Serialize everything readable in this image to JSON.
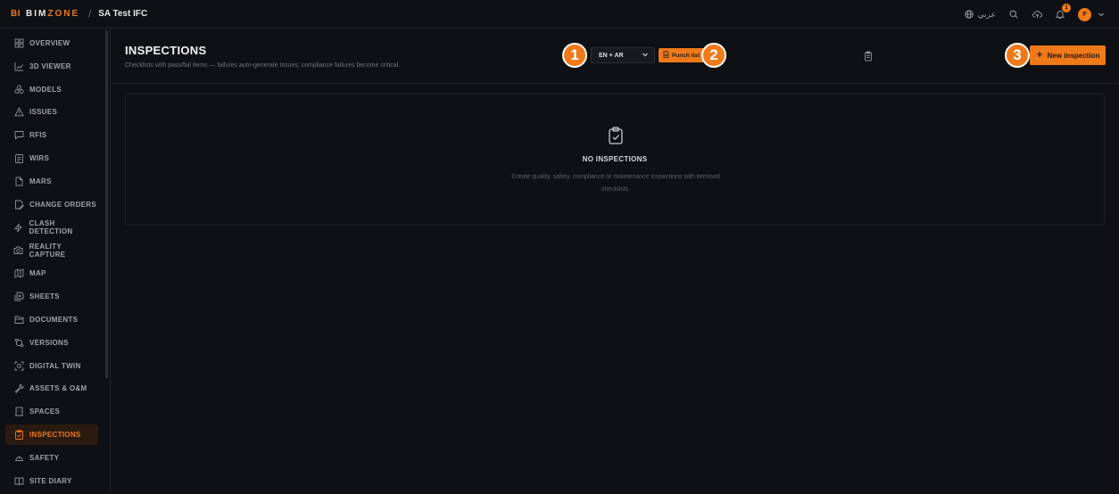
{
  "topbar": {
    "logo_badge": "BI",
    "logo_text_a": "BIM",
    "logo_text_b": "ZONE",
    "separator": "/",
    "project_name": "SA Test IFC",
    "language_label": "عربي",
    "notification_count": "1",
    "avatar_initial": "F",
    "icons": [
      "globe-icon",
      "search-icon",
      "cloud-upload-icon",
      "bell-icon",
      "chevron-down-icon"
    ]
  },
  "sidebar": {
    "items": [
      {
        "label": "OVERVIEW",
        "icon": "grid-icon",
        "active": false
      },
      {
        "label": "3D VIEWER",
        "icon": "chart-icon",
        "active": false
      },
      {
        "label": "MODELS",
        "icon": "boxes-icon",
        "active": false
      },
      {
        "label": "ISSUES",
        "icon": "warning-icon",
        "active": false
      },
      {
        "label": "RFIS",
        "icon": "message-icon",
        "active": false
      },
      {
        "label": "WIRS",
        "icon": "clipboard-list-icon",
        "active": false
      },
      {
        "label": "MARS",
        "icon": "file-icon",
        "active": false
      },
      {
        "label": "CHANGE ORDERS",
        "icon": "edit-file-icon",
        "active": false
      },
      {
        "label": "CLASH DETECTION",
        "icon": "lightning-icon",
        "active": false
      },
      {
        "label": "REALITY CAPTURE",
        "icon": "camera-icon",
        "active": false
      },
      {
        "label": "MAP",
        "icon": "map-icon",
        "active": false
      },
      {
        "label": "SHEETS",
        "icon": "sheets-icon",
        "active": false
      },
      {
        "label": "DOCUMENTS",
        "icon": "folder-icon",
        "active": false
      },
      {
        "label": "VERSIONS",
        "icon": "git-compare-icon",
        "active": false
      },
      {
        "label": "DIGITAL TWIN",
        "icon": "scan-icon",
        "active": false
      },
      {
        "label": "ASSETS & O&M",
        "icon": "wrench-icon",
        "active": false
      },
      {
        "label": "SPACES",
        "icon": "building-icon",
        "active": false
      },
      {
        "label": "INSPECTIONS",
        "icon": "clipboard-check-icon",
        "active": true
      },
      {
        "label": "SAFETY",
        "icon": "helmet-icon",
        "active": false
      },
      {
        "label": "SITE DIARY",
        "icon": "book-icon",
        "active": false
      }
    ]
  },
  "header": {
    "title": "INSPECTIONS",
    "subtitle": "Checklists with pass/fail items — failures auto-generate Issues; compliance failures become critical.",
    "language_select_value": "EN + AR",
    "punch_list_label": "Punch list",
    "new_inspection_label": "New inspection",
    "markers": [
      "1",
      "2",
      "3"
    ]
  },
  "empty_state": {
    "title": "NO INSPECTIONS",
    "description": "Create quality, safety, compliance or maintenance inspections with itemised checklists."
  },
  "colors": {
    "accent": "#f07a1a",
    "background": "#0f1013",
    "border": "#22242a"
  }
}
